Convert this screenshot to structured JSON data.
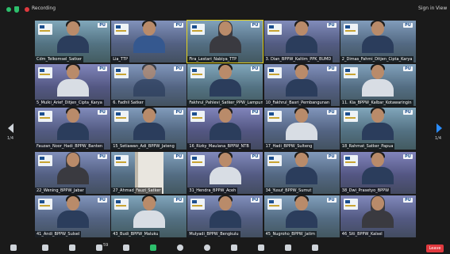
{
  "topbar": {
    "recording_label": "Recording",
    "signin_label": "Sign in",
    "view_label": "View"
  },
  "page_indicator": {
    "left": "1/4",
    "right": "1/4"
  },
  "participants": [
    {
      "name": "Cdm_Telkomsel_Satker",
      "style": "man",
      "active": false
    },
    {
      "name": "Lia_TTP",
      "style": "woman",
      "active": false
    },
    {
      "name": "Fira_Lestari_Nabiya_TTP",
      "style": "hijab",
      "active": true
    },
    {
      "name": "3. Dian_BPPW_Kaltim_PPK_BUMD",
      "style": "man",
      "active": false
    },
    {
      "name": "2_Dimas_Fahmi_Ditjen_Cipta_Karya",
      "style": "man",
      "active": false
    },
    {
      "name": "5_Mulki_Arief_Ditjen_Cipta_Karya",
      "style": "man",
      "active": false
    },
    {
      "name": "6. Fadhil Satker",
      "style": "back",
      "active": false
    },
    {
      "name": "Fakhrul_Pahlevi_Satker_PPW_Lampung",
      "style": "man",
      "active": false
    },
    {
      "name": "10_Fakhrul_Basri_Pembangunan",
      "style": "man",
      "active": false
    },
    {
      "name": "11. Kia_BPPW_Kalbar_Kotawaringin",
      "style": "man",
      "active": false
    },
    {
      "name": "Fauzan_Noor_Hadi_BPPW_Banten",
      "style": "man",
      "active": false
    },
    {
      "name": "15_Setiawan_Adi_BPPW_Jateng",
      "style": "man",
      "active": false
    },
    {
      "name": "16_Rizky_Maulana_BPPW_NTB",
      "style": "man",
      "active": false
    },
    {
      "name": "17_Hadi_BPPW_Sulteng",
      "style": "man",
      "active": false
    },
    {
      "name": "18_Rahmat_Satker_Papua",
      "style": "man",
      "active": false
    },
    {
      "name": "22_Wening_BPPW_Jabar",
      "style": "hijab",
      "active": false
    },
    {
      "name": "27_Ahmad_Fauzi_Satker",
      "style": "door",
      "active": false
    },
    {
      "name": "31_Hendra_BPPW_Aceh",
      "style": "man",
      "active": false
    },
    {
      "name": "34_Yusuf_BPPW_Sumut",
      "style": "man",
      "active": false
    },
    {
      "name": "38_Dwi_Prasetyo_BPPW",
      "style": "man",
      "active": false
    },
    {
      "name": "41_Andi_BPPW_Sulsel",
      "style": "man",
      "active": false
    },
    {
      "name": "43_Budi_BPPW_Maluku",
      "style": "man",
      "active": false
    },
    {
      "name": "Mulyadi_BPPW_Bengkulu",
      "style": "man",
      "active": false
    },
    {
      "name": "45_Nugroho_BPPW_Jatim",
      "style": "man",
      "active": false
    },
    {
      "name": "46_Siti_BPPW_Kalsel",
      "style": "hijab",
      "active": false
    }
  ],
  "toolbar": {
    "items": [
      {
        "label": "Mute"
      },
      {
        "label": "Stop Video"
      },
      {
        "label": "Security"
      },
      {
        "label": "Participants"
      },
      {
        "label": "Chat"
      },
      {
        "label": "Share Screen"
      },
      {
        "label": "Record"
      },
      {
        "label": "Reactions"
      },
      {
        "label": "Apps"
      },
      {
        "label": "Whiteboards"
      },
      {
        "label": "Notes"
      },
      {
        "label": "More"
      }
    ],
    "leave_label": "Leave",
    "participant_count": "59"
  },
  "colors": {
    "active_speaker": "#e5d21c",
    "share_green": "#2dbf6c",
    "leave_red": "#e0393e",
    "nav_blue": "#2a8cff"
  }
}
